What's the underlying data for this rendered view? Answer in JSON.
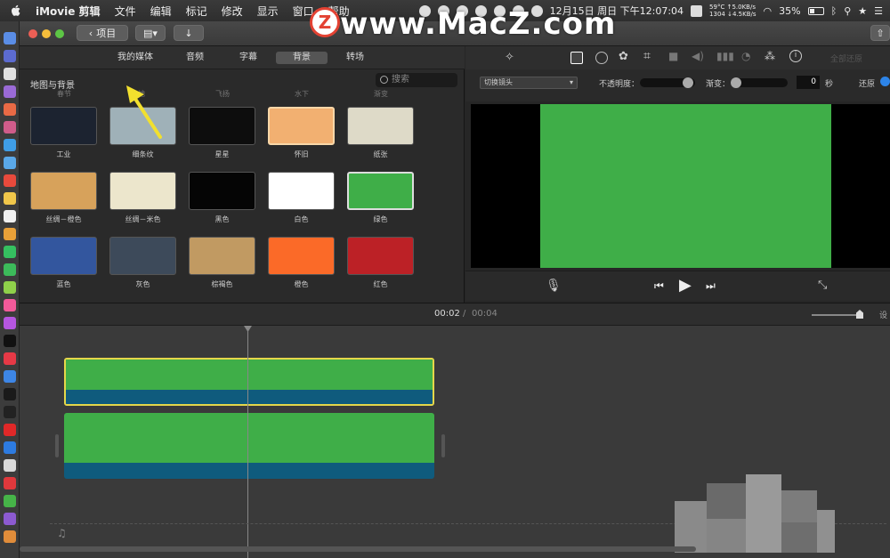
{
  "menubar": {
    "app_name": "iMovie 剪辑",
    "menus": [
      "文件",
      "编辑",
      "标记",
      "修改",
      "显示",
      "窗口",
      "帮助"
    ],
    "temp": "59°C",
    "net_up": "↑5.0KB/s",
    "rpm": "1304",
    "net_down": "↓4.5KB/s",
    "datetime": "12月15日 周日 下午12:07:04",
    "battery": "35%"
  },
  "toolbar": {
    "back_label": "项目"
  },
  "watermark": {
    "logo_letter": "Z",
    "text": "www.MacZ.com"
  },
  "browser": {
    "tabs": [
      "我的媒体",
      "音频",
      "字幕",
      "背景",
      "转场"
    ],
    "active_tab": 3,
    "library_title": "地图与背景",
    "search_placeholder": "搜索",
    "cut_labels": [
      "春节",
      "地",
      "飞扬",
      "水下",
      "渐变"
    ],
    "items": [
      {
        "label": "工业",
        "color": "#1c2330"
      },
      {
        "label": "细条纹",
        "color": "#9fb1b8"
      },
      {
        "label": "星星",
        "color": "#0d0d0d"
      },
      {
        "label": "怀旧",
        "color": "#f2b071"
      },
      {
        "label": "纸张",
        "color": "#dedac8"
      },
      {
        "label": "丝绸－橙色",
        "color": "#d7a25b"
      },
      {
        "label": "丝绸－米色",
        "color": "#ece6cc"
      },
      {
        "label": "黑色",
        "color": "#050505"
      },
      {
        "label": "白色",
        "color": "#ffffff"
      },
      {
        "label": "绿色",
        "color": "#3fae48"
      },
      {
        "label": "蓝色",
        "color": "#33569e"
      },
      {
        "label": "灰色",
        "color": "#3d4a5a"
      },
      {
        "label": "棕褐色",
        "color": "#c19a62"
      },
      {
        "label": "橙色",
        "color": "#fb6a28"
      },
      {
        "label": "红色",
        "color": "#bc2126"
      }
    ],
    "selected_item": 9
  },
  "viewer": {
    "reset_all_label": "全部还原",
    "cut_type": "切换镜头",
    "opacity_label": "不透明度：",
    "fade_label": "渐变：",
    "fade_value": "0",
    "seconds_unit": "秒",
    "reset_label": "还原",
    "preview_color": "#3fae48"
  },
  "timeline": {
    "current_time": "00:02",
    "separator": "/",
    "total_time": "00:04",
    "settings_char": "设"
  },
  "colors": {
    "clip_green": "#3fae48",
    "clip_blue": "#0f5b7d",
    "selection_yellow": "#e5d74a",
    "arrow_yellow": "#f2e02e"
  }
}
